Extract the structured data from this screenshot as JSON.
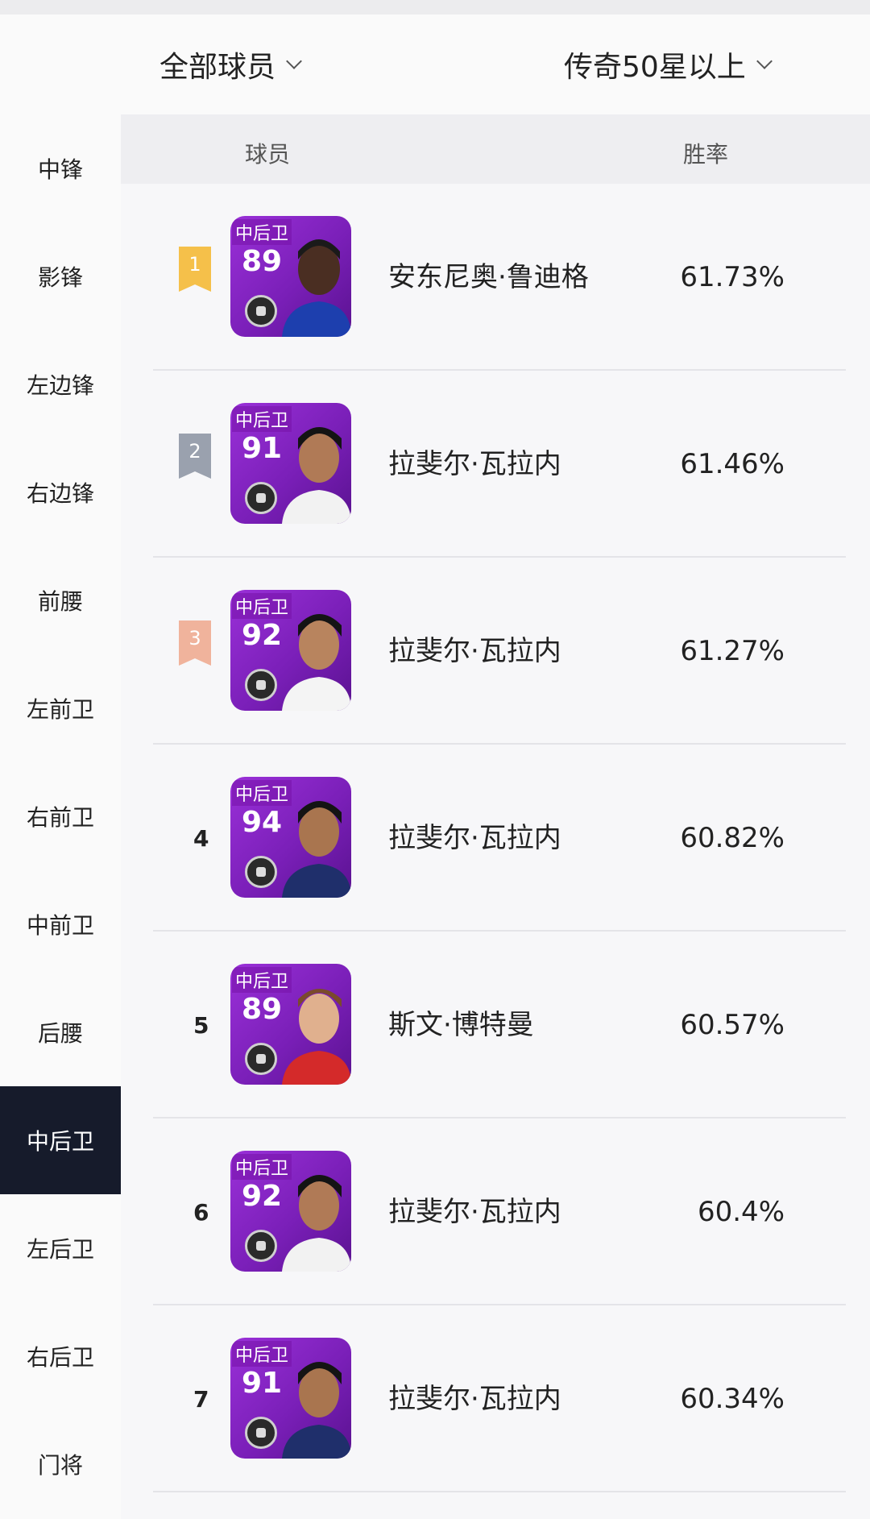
{
  "filters": {
    "left_label": "全部球员",
    "right_label": "传奇50星以上"
  },
  "sidebar": {
    "items": [
      {
        "label": "中锋"
      },
      {
        "label": "影锋"
      },
      {
        "label": "左边锋"
      },
      {
        "label": "右边锋"
      },
      {
        "label": "前腰"
      },
      {
        "label": "左前卫"
      },
      {
        "label": "右前卫"
      },
      {
        "label": "中前卫"
      },
      {
        "label": "后腰"
      },
      {
        "label": "中后卫",
        "active": true
      },
      {
        "label": "左后卫"
      },
      {
        "label": "右后卫"
      },
      {
        "label": "门将"
      }
    ]
  },
  "table": {
    "headers": {
      "player": "球员",
      "winrate": "胜率"
    },
    "rows": [
      {
        "rank": "1",
        "position": "中后卫",
        "rating": "89",
        "name": "安东尼奥·鲁迪格",
        "winrate": "61.73%"
      },
      {
        "rank": "2",
        "position": "中后卫",
        "rating": "91",
        "name": "拉斐尔·瓦拉内",
        "winrate": "61.46%"
      },
      {
        "rank": "3",
        "position": "中后卫",
        "rating": "92",
        "name": "拉斐尔·瓦拉内",
        "winrate": "61.27%"
      },
      {
        "rank": "4",
        "position": "中后卫",
        "rating": "94",
        "name": "拉斐尔·瓦拉内",
        "winrate": "60.82%"
      },
      {
        "rank": "5",
        "position": "中后卫",
        "rating": "89",
        "name": "斯文·博特曼",
        "winrate": "60.57%"
      },
      {
        "rank": "6",
        "position": "中后卫",
        "rating": "92",
        "name": "拉斐尔·瓦拉内",
        "winrate": "60.4%"
      },
      {
        "rank": "7",
        "position": "中后卫",
        "rating": "91",
        "name": "拉斐尔·瓦拉内",
        "winrate": "60.34%"
      }
    ]
  },
  "colors": {
    "active_sidebar_bg": "#161b2b",
    "rank1": "#f5c04a",
    "rank2": "#9aa1ae",
    "rank3": "#f0b39c",
    "card_purple": "#8a27c8"
  },
  "icons": {
    "dropdown": "chevron-down-icon",
    "card_emblem": "team-badge-icon"
  }
}
